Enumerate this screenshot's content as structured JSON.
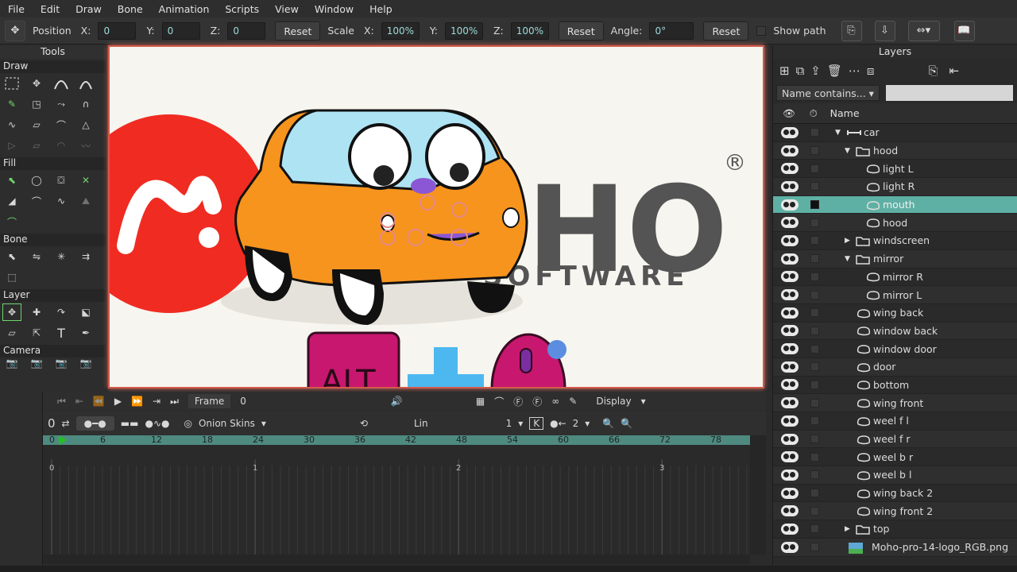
{
  "menu": [
    "File",
    "Edit",
    "Draw",
    "Bone",
    "Animation",
    "Scripts",
    "View",
    "Window",
    "Help"
  ],
  "options": {
    "position_label": "Position",
    "x_label": "X:",
    "y_label": "Y:",
    "z_label": "Z:",
    "pos_x": "0",
    "pos_y": "0",
    "pos_z": "0",
    "reset": "Reset",
    "scale_label": "Scale",
    "scale_x": "100%",
    "scale_y": "100%",
    "scale_z": "100%",
    "angle_label": "Angle:",
    "angle": "0°",
    "show_path": "Show path"
  },
  "tools": {
    "title": "Tools",
    "sections": [
      "Draw",
      "Fill",
      "Bone",
      "Layer",
      "Camera"
    ]
  },
  "layers": {
    "title": "Layers",
    "filter_label": "Name contains...",
    "name_header": "Name",
    "items": [
      {
        "name": "car",
        "indent": 0,
        "type": "bone",
        "expand": "down"
      },
      {
        "name": "hood",
        "indent": 1,
        "type": "group",
        "expand": "down"
      },
      {
        "name": "light L",
        "indent": 2,
        "type": "vector"
      },
      {
        "name": "light  R",
        "indent": 2,
        "type": "vector"
      },
      {
        "name": "mouth",
        "indent": 2,
        "type": "vector",
        "selected": true
      },
      {
        "name": "hood",
        "indent": 2,
        "type": "vector"
      },
      {
        "name": "windscreen",
        "indent": 1,
        "type": "group",
        "expand": "right"
      },
      {
        "name": "mirror",
        "indent": 1,
        "type": "group",
        "expand": "down"
      },
      {
        "name": "mirror R",
        "indent": 2,
        "type": "vector"
      },
      {
        "name": "mirror L",
        "indent": 2,
        "type": "vector"
      },
      {
        "name": "wing back",
        "indent": 1,
        "type": "vector"
      },
      {
        "name": "window back",
        "indent": 1,
        "type": "vector"
      },
      {
        "name": "window door",
        "indent": 1,
        "type": "vector"
      },
      {
        "name": "door",
        "indent": 1,
        "type": "vector"
      },
      {
        "name": "bottom",
        "indent": 1,
        "type": "vector"
      },
      {
        "name": "wing front",
        "indent": 1,
        "type": "vector"
      },
      {
        "name": "weel f l",
        "indent": 1,
        "type": "vector"
      },
      {
        "name": "weel f r",
        "indent": 1,
        "type": "vector"
      },
      {
        "name": "weel b r",
        "indent": 1,
        "type": "vector"
      },
      {
        "name": "weel b l",
        "indent": 1,
        "type": "vector"
      },
      {
        "name": "wing back 2",
        "indent": 1,
        "type": "vector"
      },
      {
        "name": "wing front 2",
        "indent": 1,
        "type": "vector"
      },
      {
        "name": "top",
        "indent": 1,
        "type": "group",
        "expand": "right"
      },
      {
        "name": "Moho-pro-14-logo_RGB.png",
        "indent": 0,
        "type": "image"
      }
    ]
  },
  "canvas": {
    "logo_text": "HO",
    "logo_sub": "SOFTWARE",
    "registered": "®",
    "overlay_key": "ALT"
  },
  "transport": {
    "frame_label": "Frame",
    "frame_value": "0",
    "display_label": "Display"
  },
  "timeline": {
    "frame_counter": "0",
    "onion_label": "Onion Skins",
    "interp_label": "Lin",
    "interp_value": "1",
    "k_label": "K",
    "step_value": "2",
    "ruler": [
      "0",
      "6",
      "12",
      "18",
      "24",
      "30",
      "36",
      "42",
      "48",
      "54",
      "60",
      "66",
      "72",
      "78"
    ],
    "seconds": [
      "0",
      "1",
      "2",
      "3"
    ]
  },
  "colors": {
    "accent": "#5fb0a4",
    "border_red": "#d45a4c",
    "logo_red": "#f02b22",
    "car_orange": "#f7941d",
    "key_magenta": "#c8176e",
    "plus_blue": "#4db8f0"
  }
}
